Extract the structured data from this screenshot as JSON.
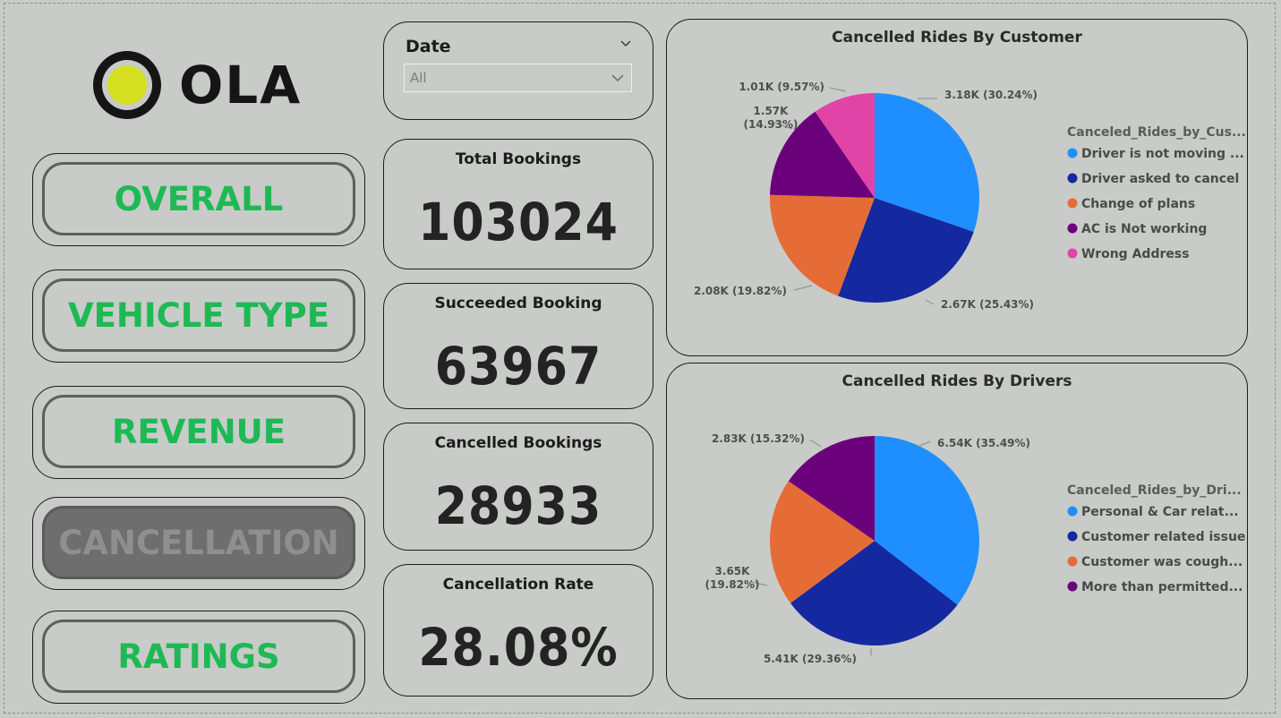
{
  "brand": {
    "name": "OLA"
  },
  "nav": [
    {
      "label": "OVERALL",
      "active": false
    },
    {
      "label": "VEHICLE TYPE",
      "active": false
    },
    {
      "label": "REVENUE",
      "active": false
    },
    {
      "label": "CANCELLATION",
      "active": true
    },
    {
      "label": "RATINGS",
      "active": false
    }
  ],
  "slicer": {
    "title": "Date",
    "value": "All"
  },
  "kpis": [
    {
      "title": "Total Bookings",
      "value": "103024"
    },
    {
      "title": "Succeeded Booking",
      "value": "63967"
    },
    {
      "title": "Cancelled Bookings",
      "value": "28933"
    },
    {
      "title": "Cancellation Rate",
      "value": "28.08%"
    }
  ],
  "chart_data": [
    {
      "type": "pie",
      "title": "Cancelled Rides By Customer",
      "legend_title": "Canceled_Rides_by_Cus...",
      "legend_placement": "right",
      "slices": [
        {
          "name": "Driver is not moving ...",
          "value": 3.18,
          "label": "3.18K (30.24%)",
          "color": "#1f8fff"
        },
        {
          "name": "Driver asked to cancel",
          "value": 2.67,
          "label": "2.67K (25.43%)",
          "color": "#1428a0"
        },
        {
          "name": "Change of plans",
          "value": 2.08,
          "label": "2.08K (19.82%)",
          "color": "#e66c37"
        },
        {
          "name": "AC is Not working",
          "value": 1.57,
          "label": "1.57K (14.93%)",
          "color": "#6b007b"
        },
        {
          "name": "Wrong Address",
          "value": 1.01,
          "label": "1.01K (9.57%)",
          "color": "#e044a7"
        }
      ]
    },
    {
      "type": "pie",
      "title": "Cancelled Rides By Drivers",
      "legend_title": "Canceled_Rides_by_Dri...",
      "legend_placement": "right",
      "slices": [
        {
          "name": "Personal & Car relat...",
          "value": 6.54,
          "label": "6.54K (35.49%)",
          "color": "#1f8fff"
        },
        {
          "name": "Customer related issue",
          "value": 5.41,
          "label": "5.41K (29.36%)",
          "color": "#1428a0"
        },
        {
          "name": "Customer was cough...",
          "value": 3.65,
          "label": "3.65K (19.82%)",
          "color": "#e66c37"
        },
        {
          "name": "More than permitted...",
          "value": 2.83,
          "label": "2.83K (15.32%)",
          "color": "#6b007b"
        }
      ]
    }
  ]
}
